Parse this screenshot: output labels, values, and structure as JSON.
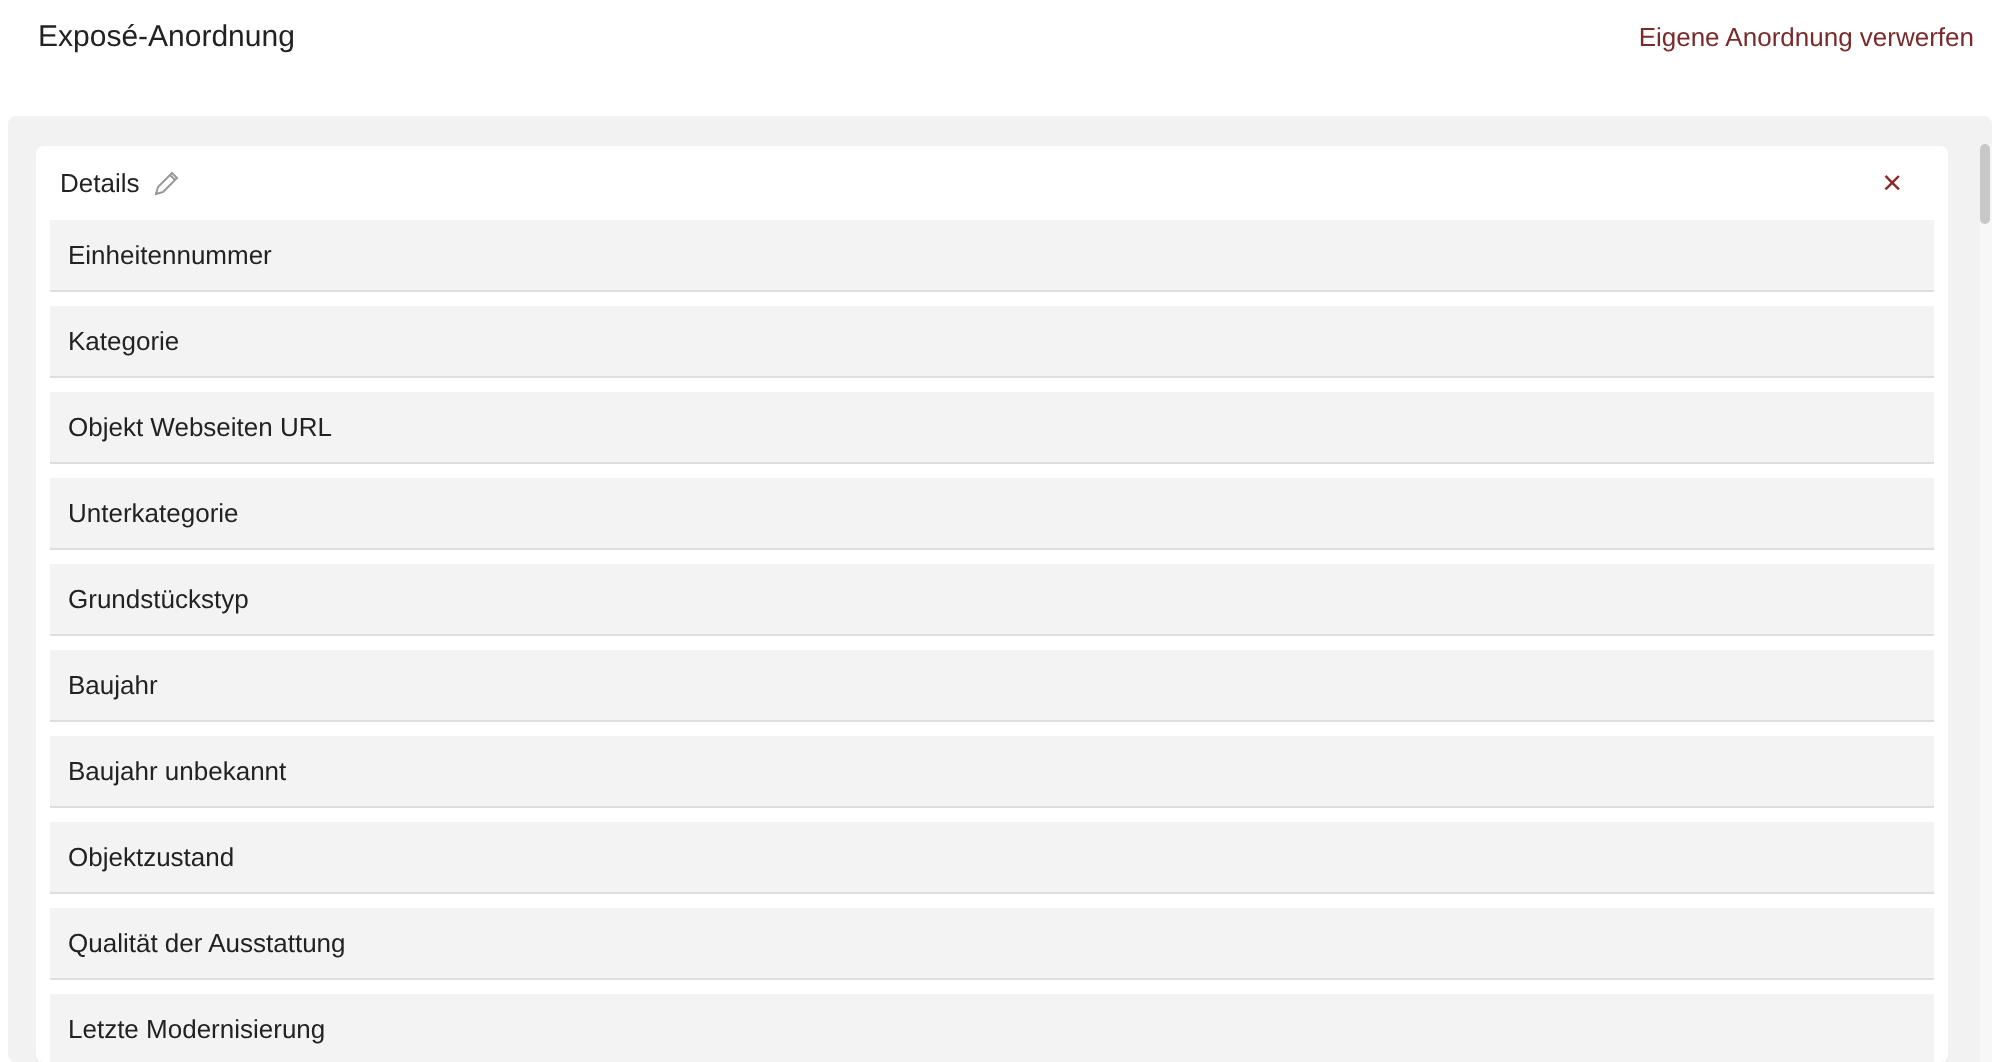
{
  "page": {
    "title": "Exposé-Anordnung",
    "reset_link": "Eigene Anordnung verwerfen"
  },
  "section": {
    "title": "Details",
    "close": "×",
    "fields": [
      {
        "label": "Einheitennummer"
      },
      {
        "label": "Kategorie"
      },
      {
        "label": "Objekt Webseiten URL"
      },
      {
        "label": "Unterkategorie"
      },
      {
        "label": "Grundstückstyp"
      },
      {
        "label": "Baujahr"
      },
      {
        "label": "Baujahr unbekannt"
      },
      {
        "label": "Objektzustand"
      },
      {
        "label": "Qualität der Ausstattung"
      },
      {
        "label": "Letzte Modernisierung"
      }
    ]
  }
}
